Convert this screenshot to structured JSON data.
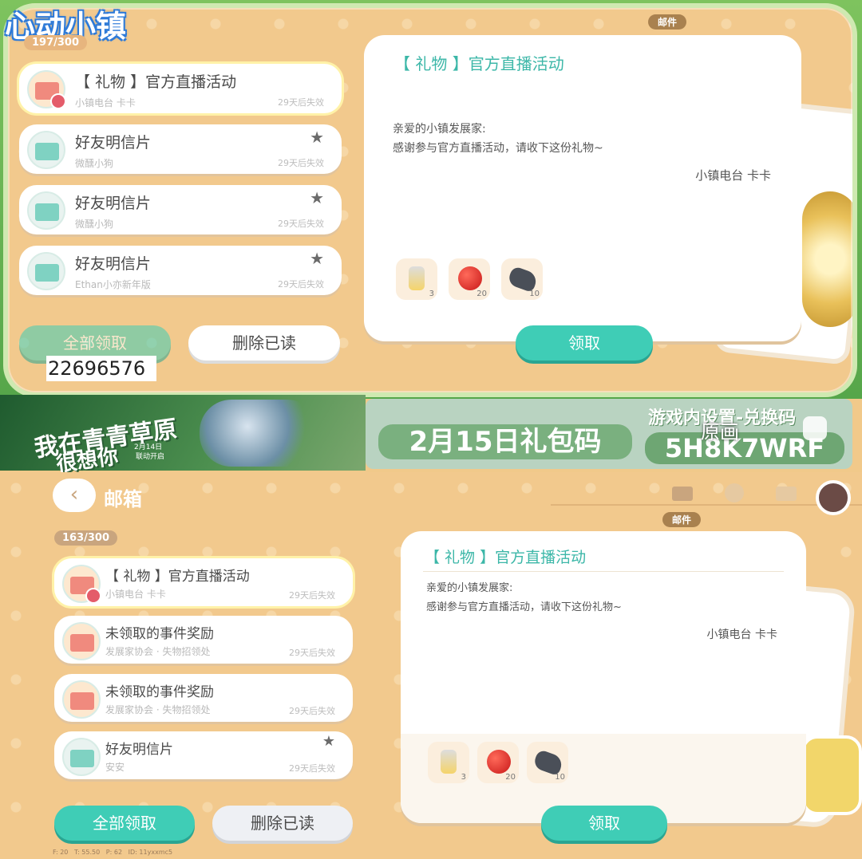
{
  "top": {
    "logo": "心动小镇",
    "count": "197/300",
    "tag": "邮件",
    "items": [
      {
        "title": "【 礼物 】官方直播活动",
        "sender": "小镇电台 卡卡",
        "expire": "29天后失效"
      },
      {
        "title": "好友明信片",
        "sender": "微醺小狗",
        "expire": "29天后失效"
      },
      {
        "title": "好友明信片",
        "sender": "微醺小狗",
        "expire": "29天后失效"
      },
      {
        "title": "好友明信片",
        "sender": "Ethan小亦新年版",
        "expire": "29天后失效"
      }
    ],
    "panel": {
      "title": "【 礼物 】官方直播活动",
      "greeting": "亲爱的小镇发展家:",
      "body": "感谢参与官方直播活动，请收下这份礼物~",
      "signature": "小镇电台 卡卡",
      "gifts": [
        {
          "count": "3"
        },
        {
          "count": "20"
        },
        {
          "count": "10"
        }
      ]
    },
    "buttons": {
      "claim_all": "全部领取",
      "delete_read": "删除已读",
      "claim": "领取"
    },
    "overlay_number": "22696576"
  },
  "banner": {
    "left_text_1": "我在青青草原",
    "left_text_2": "很想你",
    "left_small_1": "2月14日",
    "left_small_2": "联动开启",
    "code_title": "2月15日礼包码",
    "settings_text": "游戏内设置-兑换码",
    "code": "5H8K7WRF",
    "original_label": "原画"
  },
  "bottom": {
    "header_title": "邮箱",
    "count": "163/300",
    "tag": "邮件",
    "items": [
      {
        "title": "【 礼物 】官方直播活动",
        "sender": "小镇电台 卡卡",
        "expire": "29天后失效"
      },
      {
        "title": "未领取的事件奖励",
        "sender": "发展家协会 · 失物招领处",
        "expire": "29天后失效"
      },
      {
        "title": "未领取的事件奖励",
        "sender": "发展家协会 · 失物招领处",
        "expire": "29天后失效"
      },
      {
        "title": "好友明信片",
        "sender": "安安",
        "expire": "29天后失效"
      }
    ],
    "panel": {
      "title": "【 礼物 】官方直播活动",
      "greeting": "亲爱的小镇发展家:",
      "body": "感谢参与官方直播活动，请收下这份礼物~",
      "signature": "小镇电台 卡卡",
      "gifts": [
        {
          "count": "3"
        },
        {
          "count": "20"
        },
        {
          "count": "10"
        }
      ]
    },
    "buttons": {
      "claim_all": "全部领取",
      "delete_read": "删除已读",
      "claim": "领取"
    },
    "debug": "F: 20   T: 55.50   P: 62   ID: 11yxxmc5"
  },
  "colors": {
    "accent": "#3fcdb6",
    "title": "#3cb7a8",
    "bg": "#f1c98a"
  }
}
